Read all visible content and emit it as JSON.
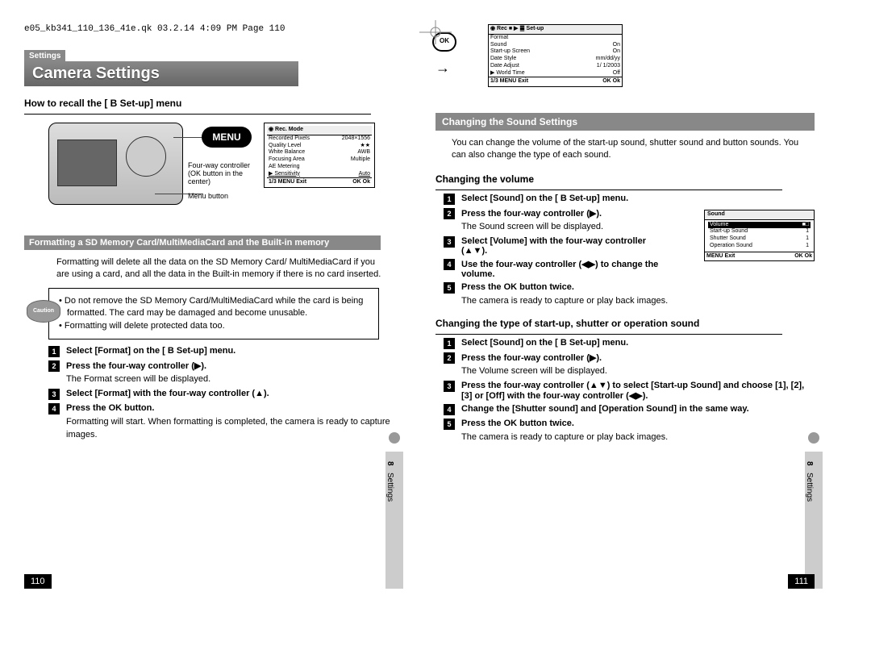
{
  "header": {
    "crop_line": "e05_kb341_110_136_41e.qk  03.2.14  4:09 PM  Page 110"
  },
  "left": {
    "breadcrumb": "Settings",
    "title": "Camera Settings",
    "recall_head": "How to recall the [ B Set-up] menu",
    "menu_pill": "MENU",
    "caption1": "Four-way controller (OK button in the center)",
    "caption2": "Menu button",
    "lcd": {
      "header": "◉ Rec. Mode",
      "rows": [
        [
          "Recorded Pixels",
          "2048×1556"
        ],
        [
          "Quality Level",
          "★★"
        ],
        [
          "White Balance",
          "AWB"
        ],
        [
          "Focusing Area",
          "Multiple"
        ],
        [
          "AE Metering",
          ""
        ],
        [
          "Sensitivity",
          "Auto"
        ]
      ],
      "footer_left": "1/3  MENU Exit",
      "footer_right": "OK Ok"
    },
    "format_title": "Formatting a SD Memory Card/MultiMediaCard and the Built-in memory",
    "format_text": "Formatting will delete all the data on the SD Memory Card/ MultiMediaCard if you are using a card, and all the data in the Built-in memory if there is no card inserted.",
    "caution_label": "Caution",
    "caution_b1": "Do not remove the SD Memory Card/MultiMediaCard while the card is being formatted. The card may be damaged and become unusable.",
    "caution_b2": "Formatting will delete protected data too.",
    "steps": {
      "s1": "Select [Format] on the [ B Set-up] menu.",
      "s2": "Press the four-way controller (▶).",
      "s2_after": "The Format screen will be displayed.",
      "s3": "Select [Format] with the four-way controller (▲).",
      "s4": "Press the OK button.",
      "s4_after": "Formatting will start. When formatting is completed, the camera is ready to capture images."
    },
    "side_label": "Settings",
    "page_num": "110",
    "num8": "8"
  },
  "right": {
    "ok_label": "OK",
    "lcd_setup": {
      "header": "◉ Rec ■ ▶ ䷀ Set-up",
      "rows": [
        [
          "Format",
          ""
        ],
        [
          "Sound",
          "On"
        ],
        [
          "Start-up Screen",
          "On"
        ],
        [
          "Date Style",
          "mm/dd/yy"
        ],
        [
          "Date Adjust",
          "1/ 1/2003"
        ],
        [
          "World Time",
          "Off"
        ]
      ],
      "footer_left": "1/3  MENU Exit",
      "footer_right": "OK Ok"
    },
    "sound_title": "Changing the Sound Settings",
    "sound_intro": "You can change the volume of the start-up sound, shutter sound and button sounds. You can also change the type of each sound.",
    "volume_head": "Changing the volume",
    "vol_steps": {
      "s1": "Select [Sound] on the [ B Set-up] menu.",
      "s2": "Press the four-way controller (▶).",
      "s2_after": "The Sound screen will be displayed.",
      "s3": "Select [Volume] with the four-way controller (▲▼).",
      "s4": "Use the four-way controller (◀▶) to change the volume.",
      "s5": "Press the OK button twice.",
      "s5_after": "The camera is ready to capture or play back images."
    },
    "lcd_sound": {
      "tab": "Sound",
      "rows": [
        [
          "Volume",
          "■□"
        ],
        [
          "Start-up Sound",
          "1"
        ],
        [
          "Shutter Sound",
          "1"
        ],
        [
          "Operation Sound",
          "1"
        ]
      ],
      "footer_left": "MENU Exit",
      "footer_right": "OK Ok"
    },
    "type_head": "Changing the type of start-up, shutter or operation sound",
    "type_steps": {
      "s1": "Select [Sound] on the [ B Set-up] menu.",
      "s2": "Press the four-way controller (▶).",
      "s2_after": "The Volume screen will be displayed.",
      "s3": "Press the four-way controller (▲▼) to select [Start-up Sound] and choose [1], [2], [3] or [Off] with the four-way controller (◀▶).",
      "s4": "Change the [Shutter sound] and [Operation Sound] in the same way.",
      "s5": "Press the OK button twice.",
      "s5_after": "The camera is ready to capture or play back images."
    },
    "side_label": "Settings",
    "page_num": "111",
    "num8": "8"
  }
}
